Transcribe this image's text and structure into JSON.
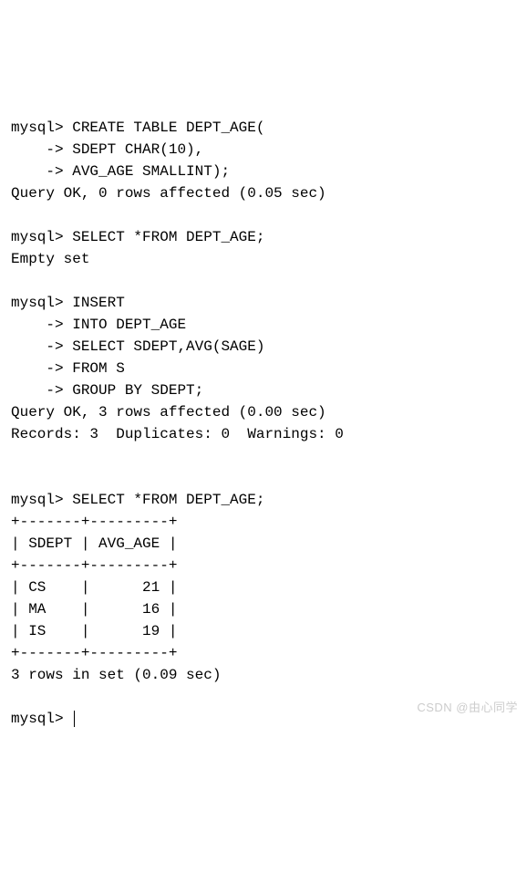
{
  "terminal": {
    "prompt": "mysql> ",
    "cont": "    -> ",
    "stmt1": {
      "l1": "CREATE TABLE DEPT_AGE(",
      "l2": "SDEPT CHAR(10),",
      "l3": "AVG_AGE SMALLINT);"
    },
    "result1": "Query OK, 0 rows affected (0.05 sec)",
    "stmt2": "SELECT *FROM DEPT_AGE;",
    "result2": "Empty set",
    "stmt3": {
      "l1": "INSERT",
      "l2": "INTO DEPT_AGE",
      "l3": "SELECT SDEPT,AVG(SAGE)",
      "l4": "FROM S",
      "l5": "GROUP BY SDEPT;"
    },
    "result3a": "Query OK, 3 rows affected (0.00 sec)",
    "result3b": "Records: 3  Duplicates: 0  Warnings: 0",
    "stmt4": "SELECT *FROM DEPT_AGE;",
    "table": {
      "sep": "+-------+---------+",
      "header": "| SDEPT | AVG_AGE |",
      "rows": [
        "| CS    |      21 |",
        "| MA    |      16 |",
        "| IS    |      19 |"
      ],
      "footer": "3 rows in set (0.09 sec)"
    }
  },
  "chart_data": {
    "type": "table",
    "title": "DEPT_AGE",
    "columns": [
      "SDEPT",
      "AVG_AGE"
    ],
    "rows": [
      {
        "SDEPT": "CS",
        "AVG_AGE": 21
      },
      {
        "SDEPT": "MA",
        "AVG_AGE": 16
      },
      {
        "SDEPT": "IS",
        "AVG_AGE": 19
      }
    ]
  },
  "watermark": "CSDN @由心同学"
}
